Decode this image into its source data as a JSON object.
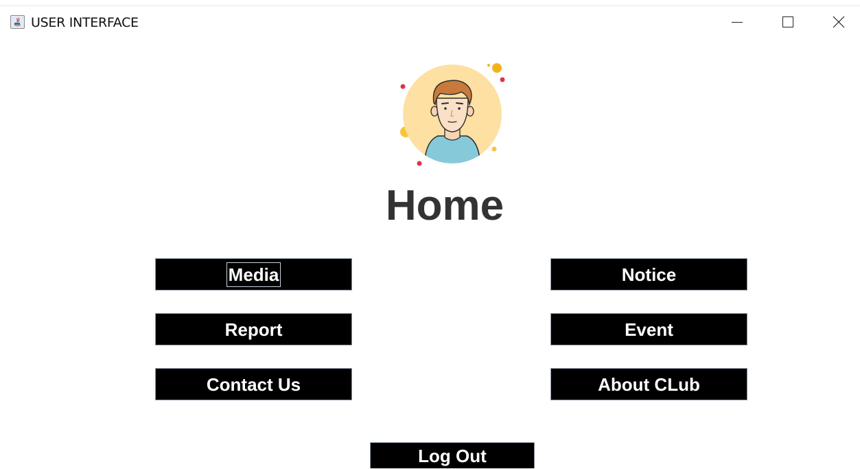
{
  "window": {
    "title": "USER INTERFACE",
    "controls": [
      "minimize-icon",
      "maximize-icon",
      "close-icon"
    ]
  },
  "header": {
    "title": "Home",
    "avatar_icon": "user-avatar-icon"
  },
  "menu": {
    "media": "Media",
    "notice": "Notice",
    "report": "Report",
    "event": "Event",
    "contact": "Contact Us",
    "about": "About CLub",
    "logout": "Log Out",
    "focused": "media"
  },
  "colors": {
    "button_bg": "#000000",
    "button_text": "#ffffff",
    "title_text": "#333333",
    "avatar_circle": "#fde0a2",
    "shirt": "#86cad9",
    "hair": "#c87a3c"
  }
}
